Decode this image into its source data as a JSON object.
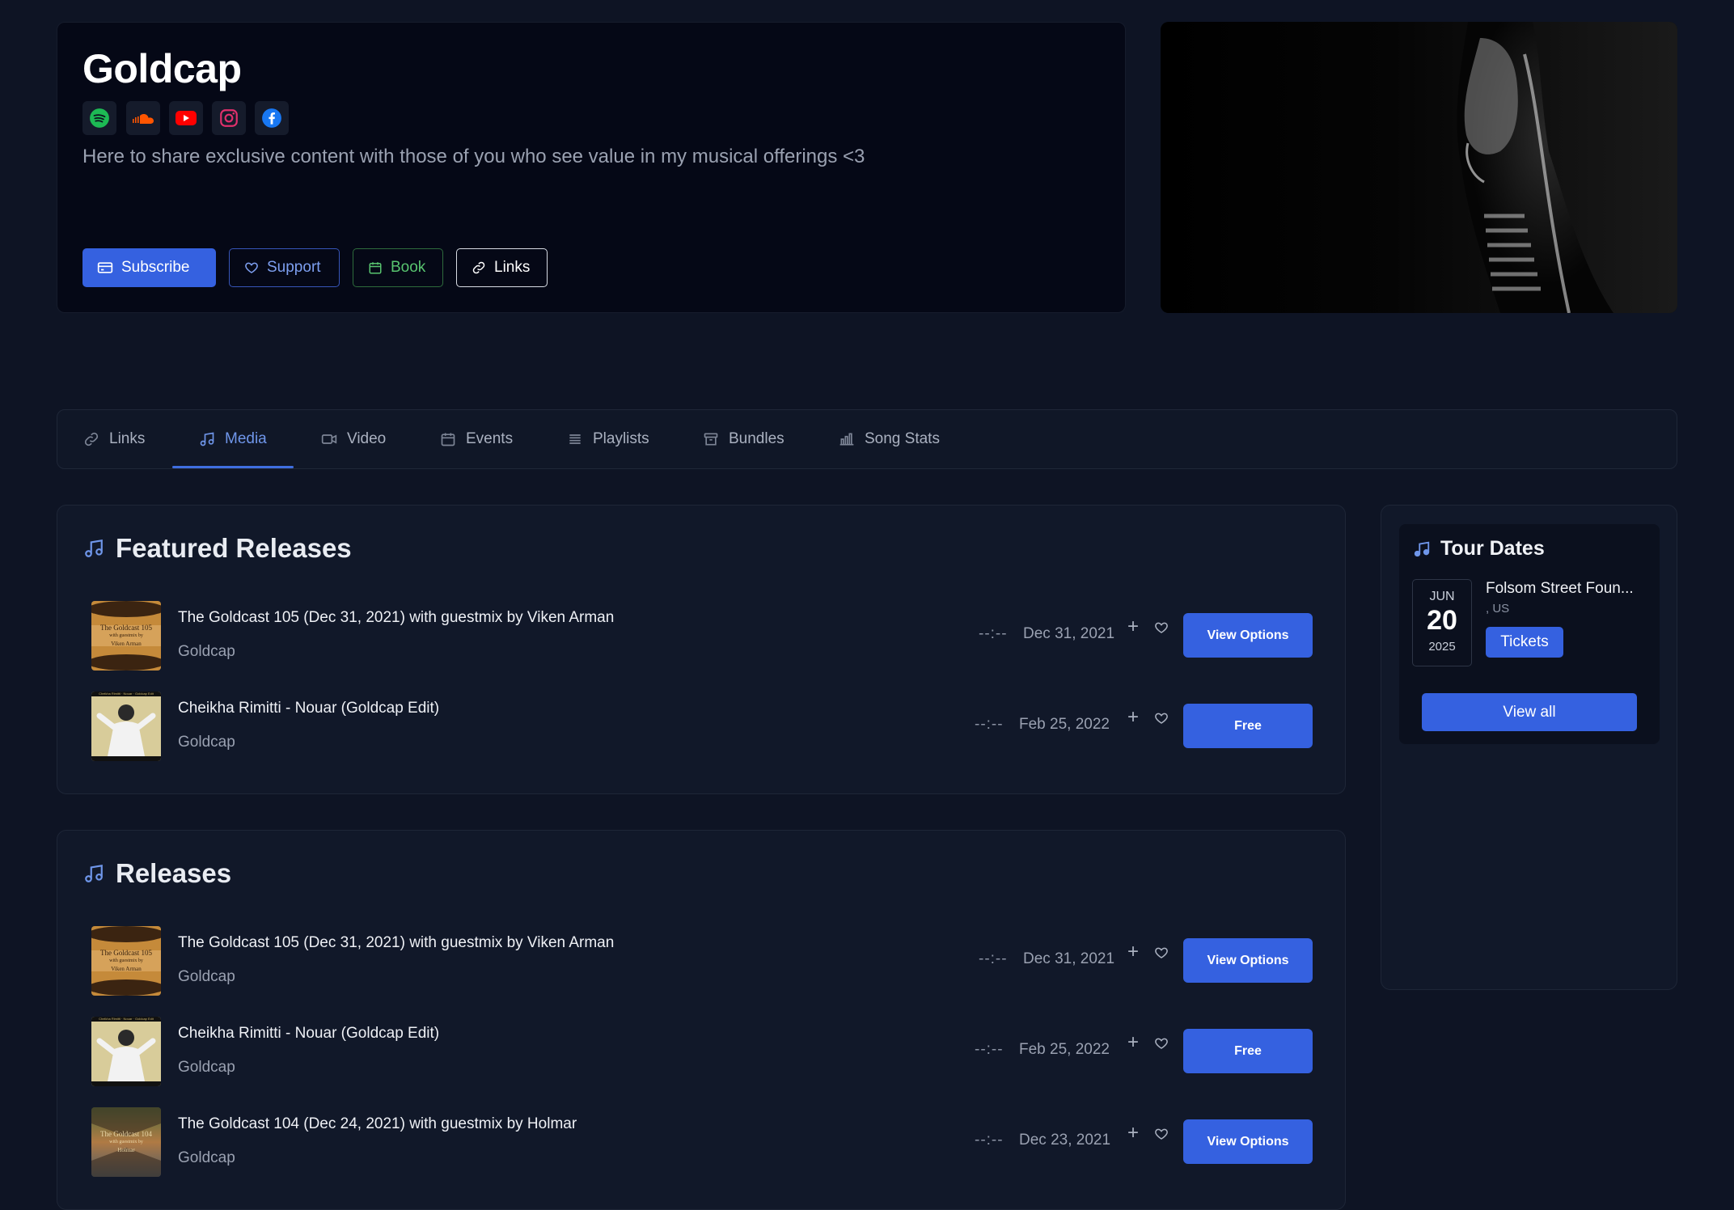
{
  "artist": {
    "name": "Goldcap",
    "bio": "Here to share exclusive content with those of you who see value in my musical offerings <3",
    "social": [
      {
        "icon": "spotify-icon",
        "color": "#1db954"
      },
      {
        "icon": "soundcloud-icon",
        "color": "#ff5500"
      },
      {
        "icon": "youtube-icon",
        "color": "#ff0000"
      },
      {
        "icon": "instagram-icon",
        "color": "#e1306c"
      },
      {
        "icon": "facebook-icon",
        "color": "#1877f2"
      }
    ],
    "buttons": {
      "subscribe": "Subscribe",
      "support": "Support",
      "book": "Book",
      "links": "Links"
    }
  },
  "tabs": [
    {
      "label": "Links",
      "icon": "link-icon"
    },
    {
      "label": "Media",
      "icon": "music-note-icon",
      "active": true
    },
    {
      "label": "Video",
      "icon": "video-icon"
    },
    {
      "label": "Events",
      "icon": "calendar-icon"
    },
    {
      "label": "Playlists",
      "icon": "list-icon"
    },
    {
      "label": "Bundles",
      "icon": "archive-icon"
    },
    {
      "label": "Song Stats",
      "icon": "bar-chart-icon"
    }
  ],
  "featured": {
    "title": "Featured Releases",
    "items": [
      {
        "title": "The Goldcast 105 (Dec 31, 2021) with guestmix by Viken Arman",
        "artist": "Goldcap",
        "duration": "--:--",
        "date": "Dec 31, 2021",
        "action": "View Options"
      },
      {
        "title": "Cheikha Rimitti - Nouar (Goldcap Edit)",
        "artist": "Goldcap",
        "duration": "--:--",
        "date": "Feb 25, 2022",
        "action": "Free"
      }
    ]
  },
  "releases": {
    "title": "Releases",
    "items": [
      {
        "title": "The Goldcast 105 (Dec 31, 2021) with guestmix by Viken Arman",
        "artist": "Goldcap",
        "duration": "--:--",
        "date": "Dec 31, 2021",
        "action": "View Options"
      },
      {
        "title": "Cheikha Rimitti - Nouar (Goldcap Edit)",
        "artist": "Goldcap",
        "duration": "--:--",
        "date": "Feb 25, 2022",
        "action": "Free"
      },
      {
        "title": "The Goldcast 104 (Dec 24, 2021) with guestmix by Holmar",
        "artist": "Goldcap",
        "duration": "--:--",
        "date": "Dec 23, 2021",
        "action": "View Options"
      }
    ]
  },
  "tour": {
    "title": "Tour Dates",
    "event": {
      "month": "JUN",
      "day": "20",
      "year": "2025",
      "name": "Folsom Street Foun...",
      "location": ", US",
      "tickets": "Tickets"
    },
    "view_all": "View all"
  },
  "thumbnails": {
    "goldcast105": {
      "line1": "The Goldcast 105",
      "line2": "with guestmix by",
      "line3": "Viken Arman"
    },
    "goldcast104": {
      "line1": "The Goldcast 104",
      "line2": "with guestmix by",
      "line3": "Holmar"
    },
    "rimitti": {
      "caption": "Cheikha Rimitti · Nouar · Goldcap Edit"
    }
  }
}
